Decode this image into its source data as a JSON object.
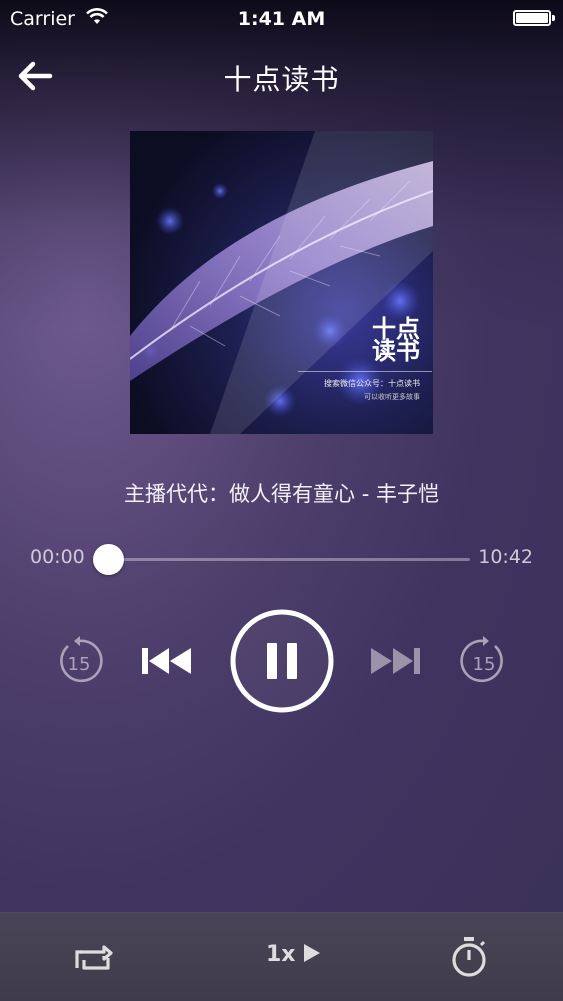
{
  "status_bar": {
    "carrier": "Carrier",
    "time": "1:41 AM"
  },
  "nav": {
    "title": "十点读书"
  },
  "cover": {
    "logo_line1": "十点",
    "logo_line2": "读书",
    "caption_line1": "搜索微信公众号：十点读书",
    "caption_line2": "可以收听更多故事"
  },
  "player": {
    "track_title": "主播代代：做人得有童心 - 丰子恺",
    "current_time": "00:00",
    "duration": "10:42",
    "progress": 0,
    "rewind_seconds": "15",
    "forward_seconds": "15",
    "state": "playing"
  },
  "bottom_bar": {
    "speed_label": "1x"
  },
  "icons": [
    "back-arrow-icon",
    "rewind-15-icon",
    "previous-track-icon",
    "pause-icon",
    "next-track-icon",
    "forward-15-icon",
    "repeat-icon",
    "speed-play-icon",
    "timer-icon"
  ]
}
